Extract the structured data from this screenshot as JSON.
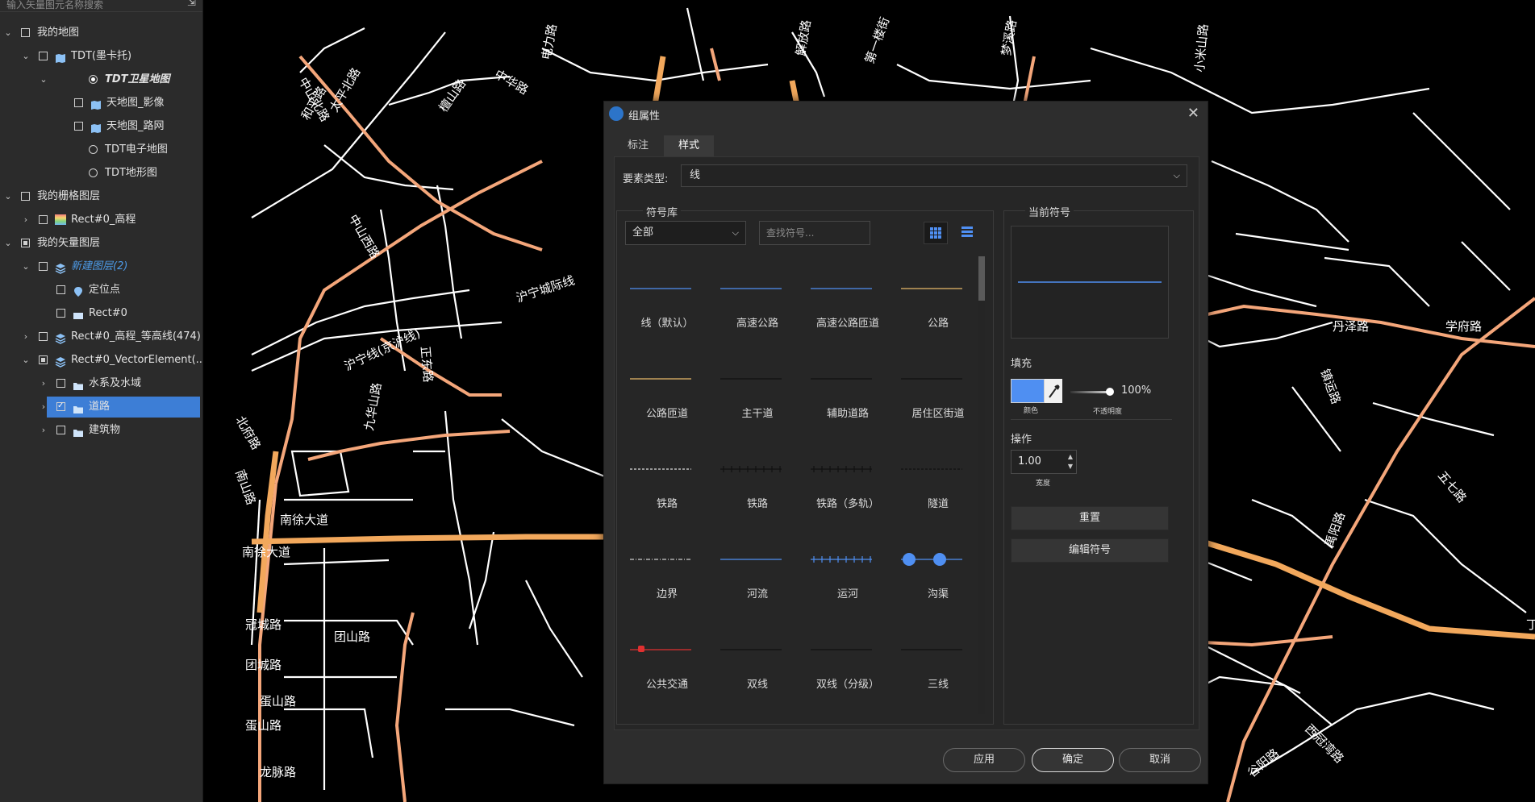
{
  "layer_panel": {
    "search_placeholder": "输入矢量图元名称搜索",
    "collapse_icon": "collapse-arrow-icon",
    "items": [
      {
        "label": "我的地图",
        "level": 0,
        "expanded": true,
        "check": "none"
      },
      {
        "label": "TDT(墨卡托)",
        "level": 1,
        "expanded": true,
        "check": "none",
        "icon": "map-icon"
      },
      {
        "label": "TDT卫星地图",
        "level": 2,
        "expanded": true,
        "radio": "on",
        "style": "italic"
      },
      {
        "label": "天地图_影像",
        "level": 3,
        "check": "none",
        "icon": "map-icon"
      },
      {
        "label": "天地图_路网",
        "level": 3,
        "check": "none",
        "icon": "map-icon"
      },
      {
        "label": "TDT电子地图",
        "level": 2,
        "radio": "off"
      },
      {
        "label": "TDT地形图",
        "level": 2,
        "radio": "off"
      },
      {
        "label": "我的栅格图层",
        "level": 0,
        "expanded": true,
        "check": "none"
      },
      {
        "label": "Rect#0_高程",
        "level": 1,
        "expanded": false,
        "check": "none",
        "icon": "raster-icon"
      },
      {
        "label": "我的矢量图层",
        "level": 0,
        "expanded": true,
        "check": "partial"
      },
      {
        "label": "新建图层(2)",
        "level": 1,
        "expanded": true,
        "check": "none",
        "icon": "layers-icon",
        "style": "blue"
      },
      {
        "label": "定位点",
        "level": 2,
        "check": "none",
        "icon": "pin-icon"
      },
      {
        "label": "Rect#0",
        "level": 2,
        "check": "none",
        "icon": "rect-icon"
      },
      {
        "label": "Rect#0_高程_等高线(474)",
        "level": 1,
        "expanded": false,
        "check": "none",
        "icon": "layers-icon"
      },
      {
        "label": "Rect#0_VectorElement(...",
        "level": 1,
        "expanded": true,
        "check": "partial",
        "icon": "layers-icon"
      },
      {
        "label": "水系及水域",
        "level": 2,
        "expanded": false,
        "check": "none",
        "icon": "folder-icon"
      },
      {
        "label": "道路",
        "level": 2,
        "expanded": false,
        "check": "checked",
        "icon": "folder-icon",
        "selected": true
      },
      {
        "label": "建筑物",
        "level": 2,
        "expanded": false,
        "check": "none",
        "icon": "folder-icon"
      }
    ]
  },
  "map": {
    "labels": [
      "中山北路",
      "和平路",
      "太平北路",
      "中华路",
      "电力路",
      "解放路",
      "第一楼街",
      "梦溪路",
      "小米山路",
      "中山西路",
      "檀山路",
      "沪宁城际线",
      "沪宁线(京沪线)",
      "正东路",
      "九华山路",
      "北府路",
      "南山路",
      "南徐大道",
      "冠城路",
      "团山路",
      "团城路",
      "蛋山路",
      "龙脉路",
      "学府路",
      "丹泽路",
      "镇运路",
      "五七路",
      "禹阳路",
      "谷阳路",
      "西冠湾路",
      "丁卯"
    ],
    "road_color": "#ffffff",
    "main_road_color": "#f4a67a"
  },
  "dialog": {
    "title": "组属性",
    "logo_icon": "app-logo-icon",
    "close_icon": "close-icon",
    "tabs": [
      {
        "label": "标注",
        "active": false
      },
      {
        "label": "样式",
        "active": true
      }
    ],
    "feature_type_label": "要素类型:",
    "feature_type_value": "线",
    "symbol_library": {
      "title": "符号库",
      "category_value": "全部",
      "search_placeholder": "查找符号...",
      "grid_view_icon": "grid-view-icon",
      "list_view_icon": "list-view-icon",
      "symbols": [
        {
          "label": "线（默认）",
          "kind": "solid",
          "color": "#4f8ff2"
        },
        {
          "label": "高速公路",
          "kind": "solid",
          "color": "#4f8ff2"
        },
        {
          "label": "高速公路匝道",
          "kind": "solid",
          "color": "#4f8ff2"
        },
        {
          "label": "公路",
          "kind": "solid",
          "color": "#e8b96a"
        },
        {
          "label": "公路匝道",
          "kind": "solid",
          "color": "#e8b96a"
        },
        {
          "label": "主干道",
          "kind": "solid",
          "color": "#111111"
        },
        {
          "label": "辅助道路",
          "kind": "solid",
          "color": "#111111"
        },
        {
          "label": "居住区街道",
          "kind": "solid",
          "color": "#111111"
        },
        {
          "label": "铁路",
          "kind": "dashed",
          "color": "#dddddd"
        },
        {
          "label": "铁路",
          "kind": "ticked",
          "color": "#111111"
        },
        {
          "label": "铁路（多轨）",
          "kind": "ticked",
          "color": "#111111"
        },
        {
          "label": "隧道",
          "kind": "dashed",
          "color": "#111111"
        },
        {
          "label": "边界",
          "kind": "dashdot",
          "color": "#cccccc"
        },
        {
          "label": "河流",
          "kind": "solid",
          "color": "#4f8ff2"
        },
        {
          "label": "运河",
          "kind": "ticked",
          "color": "#4f8ff2"
        },
        {
          "label": "沟渠",
          "kind": "dots",
          "color": "#4f8ff2"
        },
        {
          "label": "公共交通",
          "kind": "transit",
          "color": "#e03030"
        },
        {
          "label": "双线",
          "kind": "solid",
          "color": "#111111"
        },
        {
          "label": "双线（分级）",
          "kind": "solid",
          "color": "#111111"
        },
        {
          "label": "三线",
          "kind": "solid",
          "color": "#111111"
        }
      ]
    },
    "current_symbol": {
      "title": "当前符号",
      "preview_color": "#4f8ff2",
      "fill_label": "填充",
      "color_caption": "颜色",
      "fill_color": "#4f8ff2",
      "eyedropper_icon": "eyedropper-icon",
      "opacity_value": "100%",
      "opacity_caption": "不透明度",
      "operation_label": "操作",
      "width_value": "1.00",
      "width_caption": "宽度",
      "reset_label": "重置",
      "edit_label": "编辑符号"
    },
    "footer": {
      "apply_label": "应用",
      "ok_label": "确定",
      "cancel_label": "取消"
    }
  }
}
